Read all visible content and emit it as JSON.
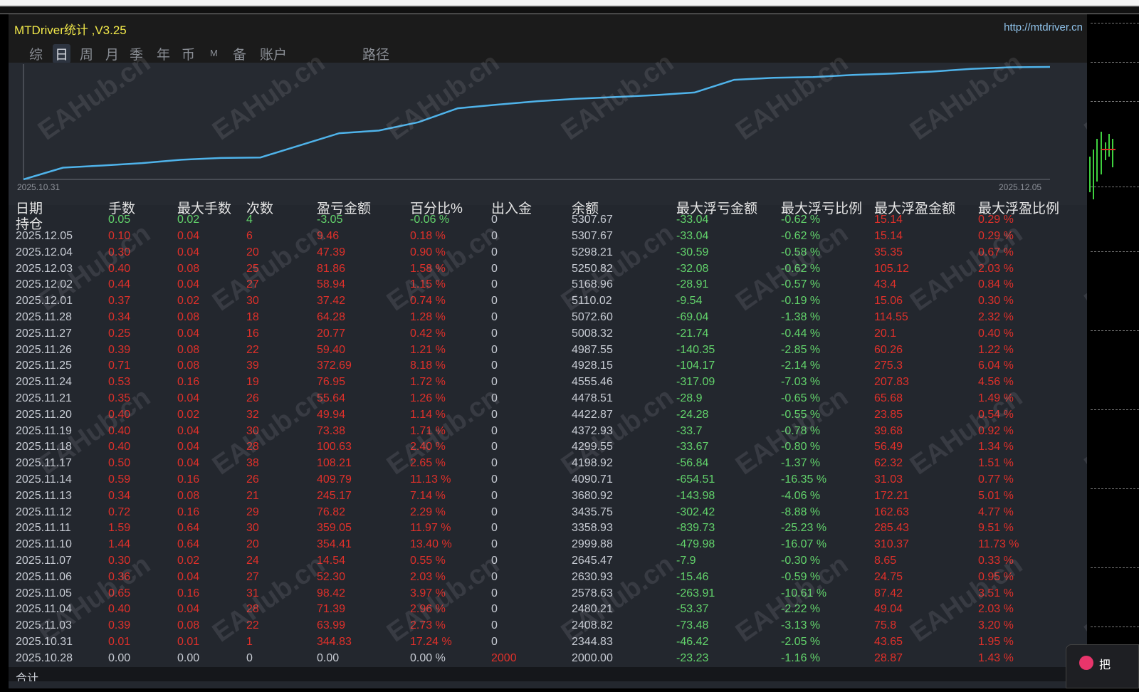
{
  "window": {
    "title": "MTDriver统计 ,V3.25",
    "url": "http://mtdriver.cn"
  },
  "tabs": [
    {
      "label": "综"
    },
    {
      "label": "日",
      "active": true
    },
    {
      "label": "周"
    },
    {
      "label": "月"
    },
    {
      "label": "季"
    },
    {
      "label": "年"
    },
    {
      "label": "币"
    },
    {
      "label": "M"
    },
    {
      "label": "备"
    },
    {
      "label": "账户"
    },
    {
      "label": "路径"
    }
  ],
  "chart": {
    "start_label": "2025.10.31",
    "end_label": "2025.12.05",
    "line_color": "#4fb3ea"
  },
  "chart_data": {
    "type": "line",
    "x": [
      "2025.10.28",
      "2025.10.31",
      "2025.11.03",
      "2025.11.04",
      "2025.11.05",
      "2025.11.06",
      "2025.11.07",
      "2025.11.10",
      "2025.11.11",
      "2025.11.12",
      "2025.11.13",
      "2025.11.14",
      "2025.11.17",
      "2025.11.18",
      "2025.11.19",
      "2025.11.20",
      "2025.11.21",
      "2025.11.24",
      "2025.11.25",
      "2025.11.26",
      "2025.11.27",
      "2025.11.28",
      "2025.12.01",
      "2025.12.02",
      "2025.12.03",
      "2025.12.04",
      "2025.12.05"
    ],
    "y": [
      2000.0,
      2344.83,
      2408.82,
      2480.21,
      2578.63,
      2630.93,
      2645.47,
      2999.88,
      3358.93,
      3435.75,
      3680.92,
      4090.71,
      4198.92,
      4299.55,
      4372.93,
      4422.87,
      4478.51,
      4555.46,
      4928.15,
      4987.55,
      5008.32,
      5072.6,
      5110.02,
      5168.96,
      5250.82,
      5298.21,
      5307.67
    ],
    "ylabel": "余额",
    "ylim": [
      2000,
      5307.67
    ]
  },
  "table": {
    "headers": [
      "日期",
      "手数",
      "最大手数",
      "次数",
      "盈亏金额",
      "百分比%",
      "出入金",
      "余额",
      "最大浮亏金额",
      "最大浮亏比例",
      "最大浮盈金额",
      "最大浮盈比例"
    ],
    "rows": [
      {
        "tone": "hold",
        "cells": [
          "持仓",
          "0.05",
          "0.02",
          "4",
          "-3.05",
          "-0.06 %",
          "0",
          "5307.67",
          "-33.04",
          "-0.62 %",
          "15.14",
          "0.29 %"
        ]
      },
      {
        "tone": "profit",
        "cells": [
          "2025.12.05",
          "0.10",
          "0.04",
          "6",
          "9.46",
          "0.18 %",
          "0",
          "5307.67",
          "-33.04",
          "-0.62 %",
          "15.14",
          "0.29 %"
        ]
      },
      {
        "tone": "profit",
        "cells": [
          "2025.12.04",
          "0.30",
          "0.04",
          "20",
          "47.39",
          "0.90 %",
          "0",
          "5298.21",
          "-30.59",
          "-0.58 %",
          "35.35",
          "0.67 %"
        ]
      },
      {
        "tone": "profit",
        "cells": [
          "2025.12.03",
          "0.40",
          "0.08",
          "25",
          "81.86",
          "1.58 %",
          "0",
          "5250.82",
          "-32.08",
          "-0.62 %",
          "105.12",
          "2.03 %"
        ]
      },
      {
        "tone": "profit",
        "cells": [
          "2025.12.02",
          "0.44",
          "0.04",
          "27",
          "58.94",
          "1.15 %",
          "0",
          "5168.96",
          "-28.91",
          "-0.57 %",
          "43.4",
          "0.84 %"
        ]
      },
      {
        "tone": "profit",
        "cells": [
          "2025.12.01",
          "0.37",
          "0.02",
          "30",
          "37.42",
          "0.74 %",
          "0",
          "5110.02",
          "-9.54",
          "-0.19 %",
          "15.06",
          "0.30 %"
        ]
      },
      {
        "tone": "profit",
        "cells": [
          "2025.11.28",
          "0.34",
          "0.08",
          "18",
          "64.28",
          "1.28 %",
          "0",
          "5072.60",
          "-69.04",
          "-1.38 %",
          "114.55",
          "2.32 %"
        ]
      },
      {
        "tone": "profit",
        "cells": [
          "2025.11.27",
          "0.25",
          "0.04",
          "16",
          "20.77",
          "0.42 %",
          "0",
          "5008.32",
          "-21.74",
          "-0.44 %",
          "20.1",
          "0.40 %"
        ]
      },
      {
        "tone": "profit",
        "cells": [
          "2025.11.26",
          "0.39",
          "0.08",
          "22",
          "59.40",
          "1.21 %",
          "0",
          "4987.55",
          "-140.35",
          "-2.85 %",
          "60.26",
          "1.22 %"
        ]
      },
      {
        "tone": "profit",
        "cells": [
          "2025.11.25",
          "0.71",
          "0.08",
          "39",
          "372.69",
          "8.18 %",
          "0",
          "4928.15",
          "-104.17",
          "-2.14 %",
          "275.3",
          "6.04 %"
        ]
      },
      {
        "tone": "profit",
        "cells": [
          "2025.11.24",
          "0.53",
          "0.16",
          "19",
          "76.95",
          "1.72 %",
          "0",
          "4555.46",
          "-317.09",
          "-7.03 %",
          "207.83",
          "4.56 %"
        ]
      },
      {
        "tone": "profit",
        "cells": [
          "2025.11.21",
          "0.35",
          "0.04",
          "26",
          "55.64",
          "1.26 %",
          "0",
          "4478.51",
          "-28.9",
          "-0.65 %",
          "65.68",
          "1.49 %"
        ]
      },
      {
        "tone": "profit",
        "cells": [
          "2025.11.20",
          "0.40",
          "0.02",
          "32",
          "49.94",
          "1.14 %",
          "0",
          "4422.87",
          "-24.28",
          "-0.55 %",
          "23.85",
          "0.54 %"
        ]
      },
      {
        "tone": "profit",
        "cells": [
          "2025.11.19",
          "0.40",
          "0.04",
          "30",
          "73.38",
          "1.71 %",
          "0",
          "4372.93",
          "-33.7",
          "-0.78 %",
          "39.68",
          "0.92 %"
        ]
      },
      {
        "tone": "profit",
        "cells": [
          "2025.11.18",
          "0.40",
          "0.04",
          "28",
          "100.63",
          "2.40 %",
          "0",
          "4299.55",
          "-33.67",
          "-0.80 %",
          "56.49",
          "1.34 %"
        ]
      },
      {
        "tone": "profit",
        "cells": [
          "2025.11.17",
          "0.50",
          "0.04",
          "38",
          "108.21",
          "2.65 %",
          "0",
          "4198.92",
          "-56.84",
          "-1.37 %",
          "62.32",
          "1.51 %"
        ]
      },
      {
        "tone": "profit",
        "cells": [
          "2025.11.14",
          "0.59",
          "0.16",
          "26",
          "409.79",
          "11.13 %",
          "0",
          "4090.71",
          "-654.51",
          "-16.35 %",
          "31.03",
          "0.77 %"
        ]
      },
      {
        "tone": "profit",
        "cells": [
          "2025.11.13",
          "0.34",
          "0.08",
          "21",
          "245.17",
          "7.14 %",
          "0",
          "3680.92",
          "-143.98",
          "-4.06 %",
          "172.21",
          "5.01 %"
        ]
      },
      {
        "tone": "profit",
        "cells": [
          "2025.11.12",
          "0.72",
          "0.16",
          "29",
          "76.82",
          "2.29 %",
          "0",
          "3435.75",
          "-302.42",
          "-8.88 %",
          "162.63",
          "4.77 %"
        ]
      },
      {
        "tone": "profit",
        "cells": [
          "2025.11.11",
          "1.59",
          "0.64",
          "30",
          "359.05",
          "11.97 %",
          "0",
          "3358.93",
          "-839.73",
          "-25.23 %",
          "285.43",
          "9.51 %"
        ]
      },
      {
        "tone": "profit",
        "cells": [
          "2025.11.10",
          "1.44",
          "0.64",
          "20",
          "354.41",
          "13.40 %",
          "0",
          "2999.88",
          "-479.98",
          "-16.07 %",
          "310.37",
          "11.73 %"
        ]
      },
      {
        "tone": "profit",
        "cells": [
          "2025.11.07",
          "0.30",
          "0.02",
          "24",
          "14.54",
          "0.55 %",
          "0",
          "2645.47",
          "-7.9",
          "-0.30 %",
          "8.65",
          "0.33 %"
        ]
      },
      {
        "tone": "profit",
        "cells": [
          "2025.11.06",
          "0.36",
          "0.04",
          "27",
          "52.30",
          "2.03 %",
          "0",
          "2630.93",
          "-15.46",
          "-0.59 %",
          "24.75",
          "0.95 %"
        ]
      },
      {
        "tone": "profit",
        "cells": [
          "2025.11.05",
          "0.65",
          "0.16",
          "31",
          "98.42",
          "3.97 %",
          "0",
          "2578.63",
          "-263.91",
          "-10.61 %",
          "87.42",
          "3.51 %"
        ]
      },
      {
        "tone": "profit",
        "cells": [
          "2025.11.04",
          "0.40",
          "0.04",
          "28",
          "71.39",
          "2.96 %",
          "0",
          "2480.21",
          "-53.37",
          "-2.22 %",
          "49.04",
          "2.03 %"
        ]
      },
      {
        "tone": "profit",
        "cells": [
          "2025.11.03",
          "0.39",
          "0.08",
          "22",
          "63.99",
          "2.73 %",
          "0",
          "2408.82",
          "-73.48",
          "-3.13 %",
          "75.8",
          "3.20 %"
        ]
      },
      {
        "tone": "profit",
        "cells": [
          "2025.10.31",
          "0.01",
          "0.01",
          "1",
          "344.83",
          "17.24 %",
          "0",
          "2344.83",
          "-46.42",
          "-2.05 %",
          "43.65",
          "1.95 %"
        ]
      },
      {
        "tone": "deposit",
        "cells": [
          "2025.10.28",
          "0.00",
          "0.00",
          "0",
          "0.00",
          "0.00 %",
          "2000",
          "2000.00",
          "-23.23",
          "-1.16 %",
          "28.87",
          "1.43 %"
        ]
      },
      {
        "tone": "total",
        "cells": [
          "合计",
          "",
          "",
          "",
          "",
          "",
          "",
          "",
          "",
          "",
          "",
          ""
        ]
      }
    ]
  },
  "watermark": "EAHub.cn",
  "toast": {
    "text": "把"
  },
  "colors": {
    "profit": "#e0302a",
    "loss": "#62d36b",
    "title": "#f2e94a",
    "url": "#8fc2ea"
  }
}
